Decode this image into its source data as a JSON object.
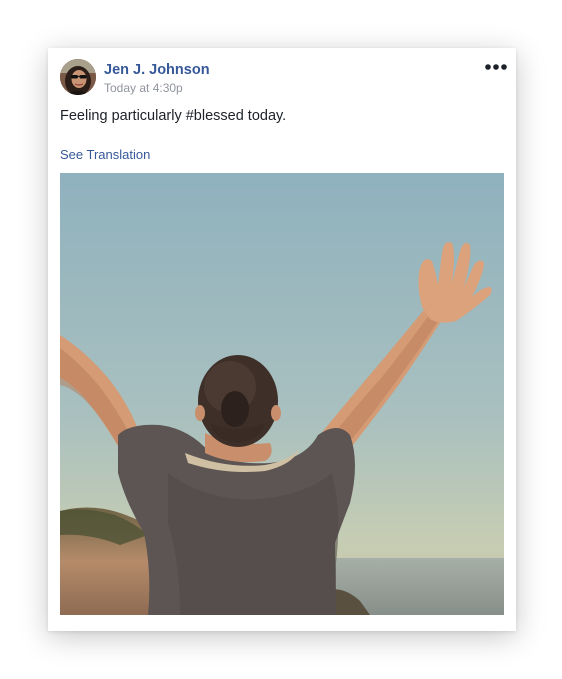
{
  "post": {
    "author": {
      "name": "Jen J. Johnson",
      "avatar_alt": "Jen J. Johnson profile photo"
    },
    "timestamp": "Today at 4:30p",
    "more_icon": "more-options-icon",
    "text": "Feeling particularly #blessed today.",
    "translation_link": "See Translation",
    "photo": {
      "description_icon": "photo-person-arms-raised"
    }
  },
  "colors": {
    "link": "#365899",
    "body_text": "#1d2129",
    "muted_text": "#90949c",
    "sky_top": "#8fb1be",
    "sky_bottom": "#c9cfb0"
  }
}
